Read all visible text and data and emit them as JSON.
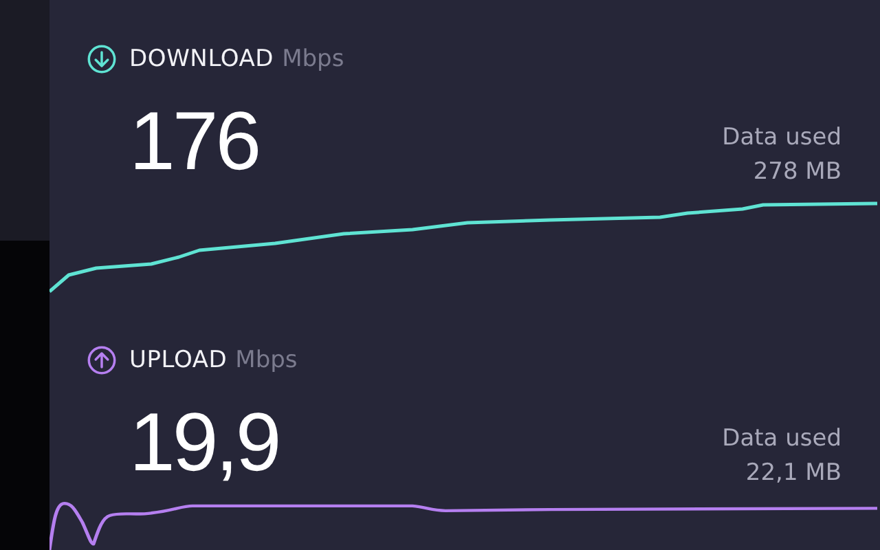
{
  "results": [
    {
      "kind": "download",
      "label": "DOWNLOAD",
      "unit": "Mbps",
      "value": "176",
      "data_label": "Data used",
      "data_value": "278 MB",
      "color": "#5fe3d3"
    },
    {
      "kind": "upload",
      "label": "UPLOAD",
      "unit": "Mbps",
      "value": "19,9",
      "data_label": "Data used",
      "data_value": "22,1 MB",
      "color": "#b57ff0"
    }
  ]
}
